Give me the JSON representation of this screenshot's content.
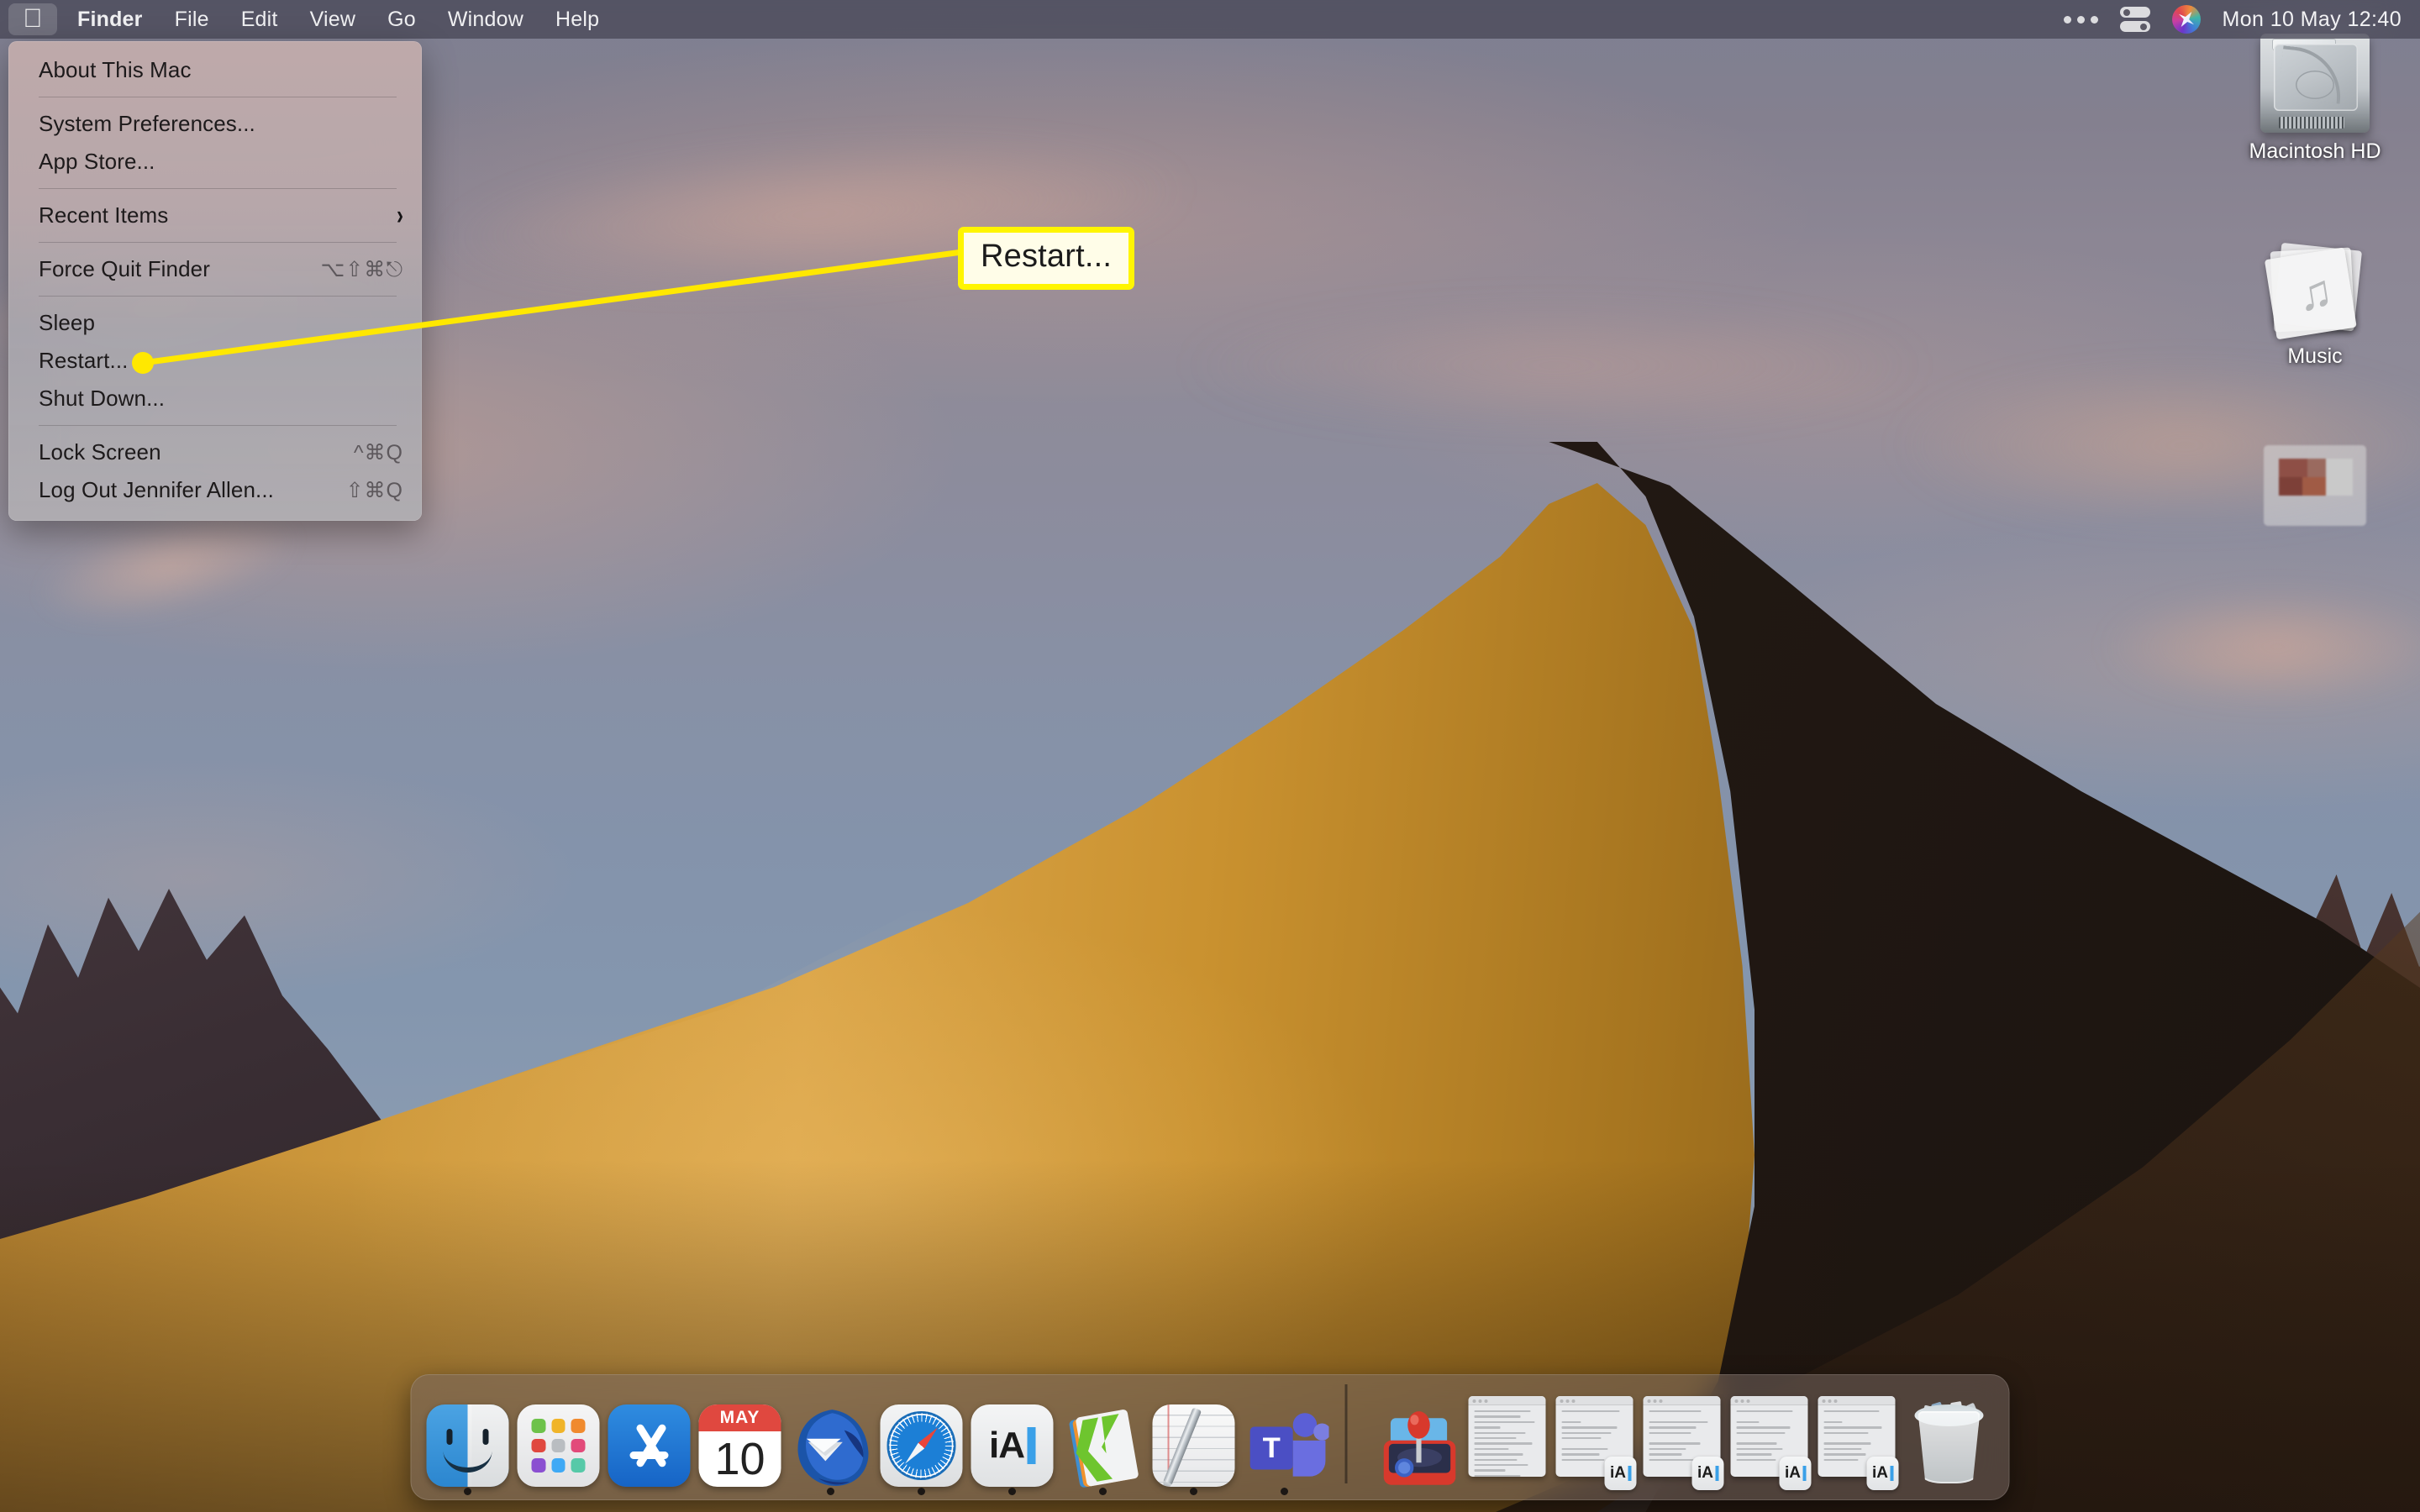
{
  "menubar": {
    "apple_icon": "apple-logo-icon",
    "items": [
      {
        "label": "Finder",
        "bold": true
      },
      {
        "label": "File",
        "bold": false
      },
      {
        "label": "Edit",
        "bold": false
      },
      {
        "label": "View",
        "bold": false
      },
      {
        "label": "Go",
        "bold": false
      },
      {
        "label": "Window",
        "bold": false
      },
      {
        "label": "Help",
        "bold": false
      }
    ],
    "status": {
      "more_icon": "ellipsis-icon",
      "control_center_icon": "control-center-icon",
      "siri_icon": "siri-icon",
      "clock": "Mon 10 May  12:40"
    }
  },
  "apple_menu": {
    "items": [
      {
        "label": "About This Mac",
        "shortcut": "",
        "submenu": false
      },
      {
        "separator": true
      },
      {
        "label": "System Preferences...",
        "shortcut": "",
        "submenu": false
      },
      {
        "label": "App Store...",
        "shortcut": "",
        "submenu": false
      },
      {
        "separator": true
      },
      {
        "label": "Recent Items",
        "shortcut": "",
        "submenu": true
      },
      {
        "separator": true
      },
      {
        "label": "Force Quit Finder",
        "shortcut": "⌥⇧⌘⎋",
        "submenu": false
      },
      {
        "separator": true
      },
      {
        "label": "Sleep",
        "shortcut": "",
        "submenu": false
      },
      {
        "label": "Restart...",
        "shortcut": "",
        "submenu": false
      },
      {
        "label": "Shut Down...",
        "shortcut": "",
        "submenu": false
      },
      {
        "separator": true
      },
      {
        "label": "Lock Screen",
        "shortcut": "^⌘Q",
        "submenu": false
      },
      {
        "label": "Log Out Jennifer Allen...",
        "shortcut": "⇧⌘Q",
        "submenu": false
      }
    ]
  },
  "callout": {
    "label": "Restart...",
    "border_color": "#fff500",
    "fill_color": "#fffde8",
    "line_color": "#ffe800"
  },
  "desktop_icons": [
    {
      "name": "Macintosh HD",
      "icon": "hard-drive-icon"
    },
    {
      "name": "Music",
      "icon": "music-stack-icon"
    },
    {
      "name": "",
      "icon": "blurred-file-icon"
    }
  ],
  "dock": {
    "apps": [
      {
        "name": "Finder",
        "icon": "finder-icon",
        "running": true
      },
      {
        "name": "Launchpad",
        "icon": "launchpad-icon",
        "running": false
      },
      {
        "name": "App Store",
        "icon": "app-store-icon",
        "running": false
      },
      {
        "name": "Calendar",
        "icon": "calendar-icon",
        "running": false,
        "month": "MAY",
        "day": "10"
      },
      {
        "name": "Thunderbird",
        "icon": "thunderbird-icon",
        "running": true
      },
      {
        "name": "Safari",
        "icon": "safari-icon",
        "running": true
      },
      {
        "name": "iA Writer",
        "icon": "ia-writer-icon",
        "running": true,
        "glyph": "iA"
      },
      {
        "name": "Kite",
        "icon": "kite-icon",
        "running": true
      },
      {
        "name": "Notes",
        "icon": "notes-icon",
        "running": true
      },
      {
        "name": "Microsoft Teams",
        "icon": "microsoft-teams-icon",
        "running": true,
        "glyph": "T"
      }
    ],
    "minimized": [
      {
        "name": "Emulator",
        "icon": "joystick-icon"
      },
      {
        "name": "TextEdit document",
        "icon": "text-document-window"
      },
      {
        "name": "iA Writer document 1",
        "icon": "ia-writer-document-window",
        "glyph": "iA"
      },
      {
        "name": "iA Writer document 2",
        "icon": "ia-writer-document-window",
        "glyph": "iA"
      },
      {
        "name": "iA Writer document 3",
        "icon": "ia-writer-document-window",
        "glyph": "iA"
      },
      {
        "name": "iA Writer document 4",
        "icon": "ia-writer-document-window",
        "glyph": "iA"
      }
    ],
    "trash": {
      "name": "Trash",
      "icon": "trash-full-icon"
    }
  }
}
